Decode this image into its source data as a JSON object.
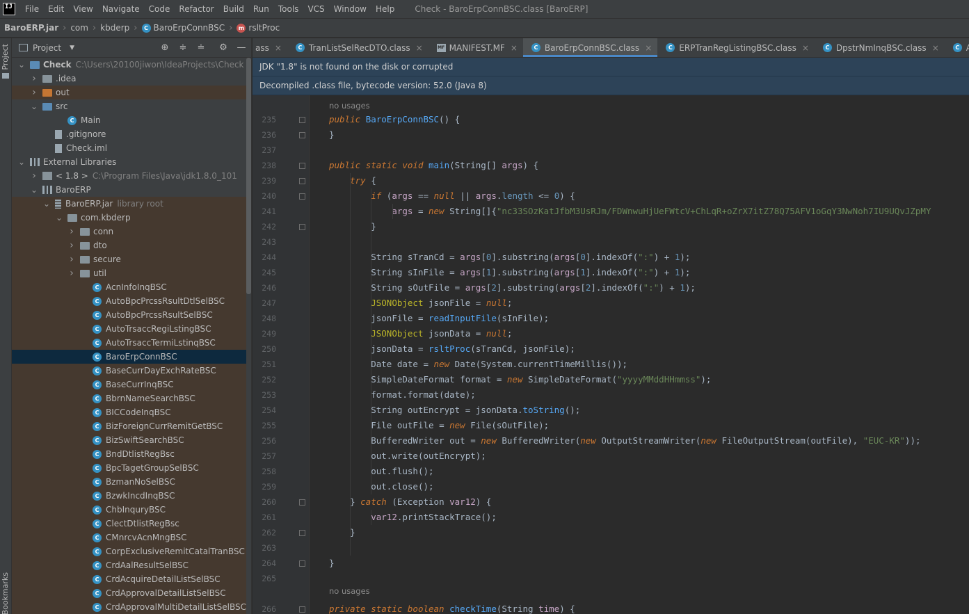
{
  "menu": {
    "items": [
      "File",
      "Edit",
      "View",
      "Navigate",
      "Code",
      "Refactor",
      "Build",
      "Run",
      "Tools",
      "VCS",
      "Window",
      "Help"
    ],
    "window_title": "Check - BaroErpConnBSC.class [BaroERP]"
  },
  "breadcrumb": {
    "jar": "BaroERP.jar",
    "pkg1": "com",
    "pkg2": "kbderp",
    "cls": "BaroErpConnBSC",
    "method": "rsltProc"
  },
  "left_stripe": {
    "project": "Project",
    "bookmarks": "Bookmarks"
  },
  "project_panel": {
    "title": "Project",
    "tree": [
      {
        "label": "Check",
        "extra": "C:\\Users\\20100jiwon\\IdeaProjects\\Check",
        "indent": 0,
        "arrow": "open",
        "icon": "folder-blue",
        "bold": true
      },
      {
        "label": ".idea",
        "indent": 1,
        "arrow": "closed",
        "icon": "folder"
      },
      {
        "label": "out",
        "indent": 1,
        "arrow": "closed",
        "icon": "folder-orange",
        "hl": "out"
      },
      {
        "label": "src",
        "indent": 1,
        "arrow": "open",
        "icon": "folder-blue"
      },
      {
        "label": "Main",
        "indent": 3,
        "arrow": "none",
        "icon": "class"
      },
      {
        "label": ".gitignore",
        "indent": 2,
        "arrow": "none",
        "icon": "file"
      },
      {
        "label": "Check.iml",
        "indent": 2,
        "arrow": "none",
        "icon": "file"
      },
      {
        "label": "External Libraries",
        "indent": 0,
        "arrow": "open",
        "icon": "lib"
      },
      {
        "label": "< 1.8 >",
        "extra": "C:\\Program Files\\Java\\jdk1.8.0_101",
        "indent": 1,
        "arrow": "closed",
        "icon": "jdk"
      },
      {
        "label": "BaroERP",
        "indent": 1,
        "arrow": "open",
        "icon": "lib"
      },
      {
        "label": "BaroERP.jar",
        "extra": "library root",
        "indent": 2,
        "arrow": "open",
        "icon": "jar",
        "hl": "lib"
      },
      {
        "label": "com.kbderp",
        "indent": 3,
        "arrow": "open",
        "icon": "folder",
        "hl": "lib"
      },
      {
        "label": "conn",
        "indent": 4,
        "arrow": "closed",
        "icon": "folder",
        "hl": "lib"
      },
      {
        "label": "dto",
        "indent": 4,
        "arrow": "closed",
        "icon": "folder",
        "hl": "lib"
      },
      {
        "label": "secure",
        "indent": 4,
        "arrow": "closed",
        "icon": "folder",
        "hl": "lib"
      },
      {
        "label": "util",
        "indent": 4,
        "arrow": "closed",
        "icon": "folder",
        "hl": "lib"
      },
      {
        "label": "AcnInfoInqBSC",
        "indent": 5,
        "arrow": "none",
        "icon": "class",
        "hl": "lib"
      },
      {
        "label": "AutoBpcPrcssRsultDtlSelBSC",
        "indent": 5,
        "arrow": "none",
        "icon": "class",
        "hl": "lib"
      },
      {
        "label": "AutoBpcPrcssRsultSelBSC",
        "indent": 5,
        "arrow": "none",
        "icon": "class",
        "hl": "lib"
      },
      {
        "label": "AutoTrsaccRegiLstingBSC",
        "indent": 5,
        "arrow": "none",
        "icon": "class",
        "hl": "lib"
      },
      {
        "label": "AutoTrsaccTermiLstinqBSC",
        "indent": 5,
        "arrow": "none",
        "icon": "class",
        "hl": "lib"
      },
      {
        "label": "BaroErpConnBSC",
        "indent": 5,
        "arrow": "none",
        "icon": "class",
        "hl": "selected"
      },
      {
        "label": "BaseCurrDayExchRateBSC",
        "indent": 5,
        "arrow": "none",
        "icon": "class",
        "hl": "lib"
      },
      {
        "label": "BaseCurrInqBSC",
        "indent": 5,
        "arrow": "none",
        "icon": "class",
        "hl": "lib"
      },
      {
        "label": "BbrnNameSearchBSC",
        "indent": 5,
        "arrow": "none",
        "icon": "class",
        "hl": "lib"
      },
      {
        "label": "BICCodeInqBSC",
        "indent": 5,
        "arrow": "none",
        "icon": "class",
        "hl": "lib"
      },
      {
        "label": "BizForeignCurrRemitGetBSC",
        "indent": 5,
        "arrow": "none",
        "icon": "class",
        "hl": "lib"
      },
      {
        "label": "BizSwiftSearchBSC",
        "indent": 5,
        "arrow": "none",
        "icon": "class",
        "hl": "lib"
      },
      {
        "label": "BndDtlistRegBsc",
        "indent": 5,
        "arrow": "none",
        "icon": "class",
        "hl": "lib"
      },
      {
        "label": "BpcTagetGroupSelBSC",
        "indent": 5,
        "arrow": "none",
        "icon": "class",
        "hl": "lib"
      },
      {
        "label": "BzmanNoSelBSC",
        "indent": 5,
        "arrow": "none",
        "icon": "class",
        "hl": "lib"
      },
      {
        "label": "BzwkIncdInqBSC",
        "indent": 5,
        "arrow": "none",
        "icon": "class",
        "hl": "lib"
      },
      {
        "label": "ChbInquryBSC",
        "indent": 5,
        "arrow": "none",
        "icon": "class",
        "hl": "lib"
      },
      {
        "label": "ClectDtlistRegBsc",
        "indent": 5,
        "arrow": "none",
        "icon": "class",
        "hl": "lib"
      },
      {
        "label": "CMnrcvAcnMngBSC",
        "indent": 5,
        "arrow": "none",
        "icon": "class",
        "hl": "lib"
      },
      {
        "label": "CorpExclusiveRemitCatalTranBSC",
        "indent": 5,
        "arrow": "none",
        "icon": "class",
        "hl": "lib"
      },
      {
        "label": "CrdAalResultSelBSC",
        "indent": 5,
        "arrow": "none",
        "icon": "class",
        "hl": "lib"
      },
      {
        "label": "CrdAcquireDetailListSelBSC",
        "indent": 5,
        "arrow": "none",
        "icon": "class",
        "hl": "lib"
      },
      {
        "label": "CrdApprovalDetailListSelBSC",
        "indent": 5,
        "arrow": "none",
        "icon": "class",
        "hl": "lib"
      },
      {
        "label": "CrdApprovalMultiDetailListSelBSC",
        "indent": 5,
        "arrow": "none",
        "icon": "class",
        "hl": "lib"
      }
    ]
  },
  "tabs": [
    {
      "label": "ass",
      "icon": "none",
      "active": false
    },
    {
      "label": "TranListSelRecDTO.class",
      "icon": "class",
      "active": false
    },
    {
      "label": "MANIFEST.MF",
      "icon": "mf",
      "active": false
    },
    {
      "label": "BaroErpConnBSC.class",
      "icon": "class",
      "active": true
    },
    {
      "label": "ERPTranRegListingBSC.class",
      "icon": "class",
      "active": false
    },
    {
      "label": "DpstrNmInqBSC.class",
      "icon": "class",
      "active": false
    },
    {
      "label": "AcnInfoInqBSC.class",
      "icon": "class",
      "active": false
    }
  ],
  "banners": {
    "jdk": "JDK \"1.8\" is not found on the disk or corrupted",
    "decompiled": "Decompiled .class file, bytecode version: 52.0 (Java 8)"
  },
  "code": {
    "hint_top": "no usages",
    "hint_bottom": "no usages",
    "lines": [
      {
        "n": "235",
        "t": "public BaroErpConnBSC() {"
      },
      {
        "n": "236",
        "t": "}"
      },
      {
        "n": "237",
        "t": ""
      },
      {
        "n": "238",
        "t": "public static void main(String[] args) {"
      },
      {
        "n": "239",
        "t": "    try {"
      },
      {
        "n": "240",
        "t": "        if (args == null || args.length <= 0) {"
      },
      {
        "n": "241",
        "t": "            args = new String[]{\"nc33SOzKatJfbM3UsRJm/FDWnwuHjUeFWtcV+ChLqR+oZrX7itZ78Q75AFV1oGqY3NwNoh7IU9UQvJZpMY"
      },
      {
        "n": "242",
        "t": "        }"
      },
      {
        "n": "243",
        "t": ""
      },
      {
        "n": "244",
        "t": "        String sTranCd = args[0].substring(args[0].indexOf(\":\") + 1);"
      },
      {
        "n": "245",
        "t": "        String sInFile = args[1].substring(args[1].indexOf(\":\") + 1);"
      },
      {
        "n": "246",
        "t": "        String sOutFile = args[2].substring(args[2].indexOf(\":\") + 1);"
      },
      {
        "n": "247",
        "t": "        JSONObject jsonFile = null;"
      },
      {
        "n": "248",
        "t": "        jsonFile = readInputFile(sInFile);"
      },
      {
        "n": "249",
        "t": "        JSONObject jsonData = null;"
      },
      {
        "n": "250",
        "t": "        jsonData = rsltProc(sTranCd, jsonFile);"
      },
      {
        "n": "251",
        "t": "        Date date = new Date(System.currentTimeMillis());"
      },
      {
        "n": "252",
        "t": "        SimpleDateFormat format = new SimpleDateFormat(\"yyyyMMddHHmmss\");"
      },
      {
        "n": "253",
        "t": "        format.format(date);"
      },
      {
        "n": "254",
        "t": "        String outEncrypt = jsonData.toString();"
      },
      {
        "n": "255",
        "t": "        File outFile = new File(sOutFile);"
      },
      {
        "n": "256",
        "t": "        BufferedWriter out = new BufferedWriter(new OutputStreamWriter(new FileOutputStream(outFile), \"EUC-KR\"));"
      },
      {
        "n": "257",
        "t": "        out.write(outEncrypt);"
      },
      {
        "n": "258",
        "t": "        out.flush();"
      },
      {
        "n": "259",
        "t": "        out.close();"
      },
      {
        "n": "260",
        "t": "    } catch (Exception var12) {"
      },
      {
        "n": "261",
        "t": "        var12.printStackTrace();"
      },
      {
        "n": "262",
        "t": "    }"
      },
      {
        "n": "263",
        "t": ""
      },
      {
        "n": "264",
        "t": "}"
      },
      {
        "n": "265",
        "t": ""
      },
      {
        "n": "266",
        "t": "private static boolean checkTime(String time) {"
      }
    ]
  },
  "colors": {
    "accent": "#4a88c7",
    "banner_bg": "#2d4358",
    "library_highlight": "#45392f",
    "keyword": "#cc7832",
    "string": "#6a8759",
    "number": "#6897bb"
  }
}
